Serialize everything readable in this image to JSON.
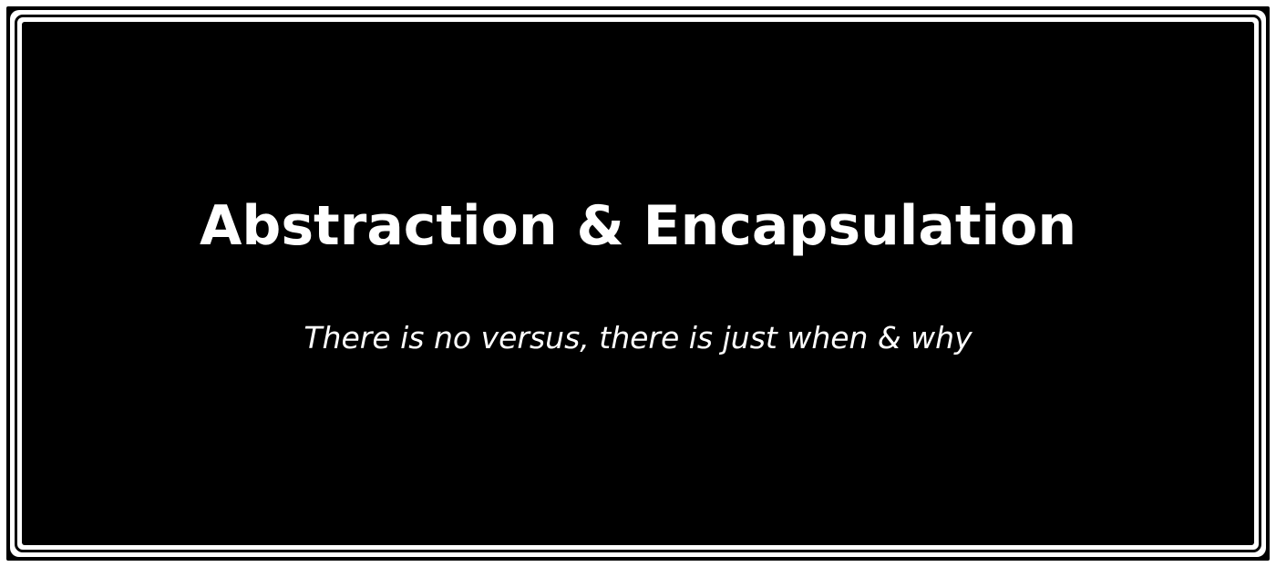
{
  "slide": {
    "title": "Abstraction & Encapsulation",
    "subtitle": "There is no versus, there is just when & why"
  },
  "colors": {
    "background": "#000000",
    "text": "#ffffff",
    "frame": "#ffffff"
  }
}
